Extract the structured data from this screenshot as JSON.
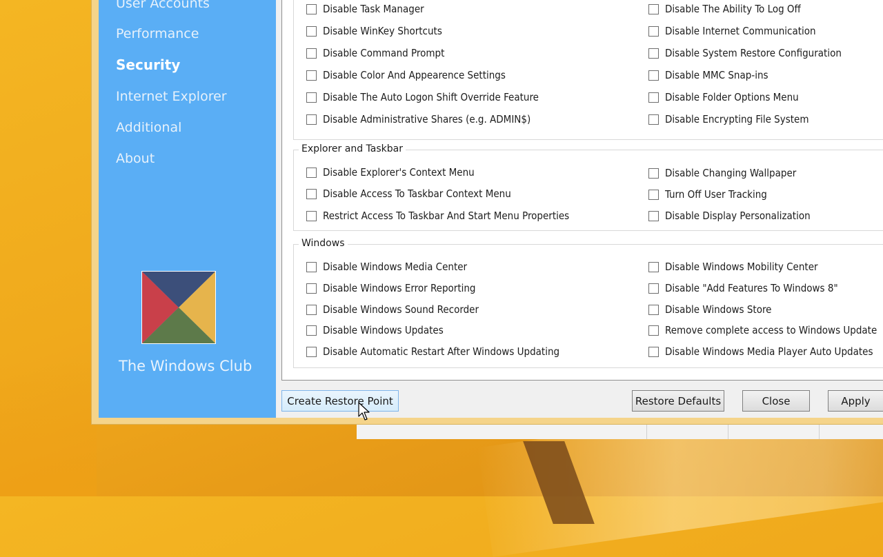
{
  "sidebar": {
    "items": [
      {
        "label": "User Accounts",
        "active": false
      },
      {
        "label": "Performance",
        "active": false
      },
      {
        "label": "Security",
        "active": true
      },
      {
        "label": "Internet Explorer",
        "active": false
      },
      {
        "label": "Additional",
        "active": false
      },
      {
        "label": "About",
        "active": false
      }
    ],
    "brand": "The Windows Club",
    "accent_color": "#5aaef5"
  },
  "groups": {
    "system": {
      "left": [
        "Disable Task Manager",
        "Disable WinKey Shortcuts",
        "Disable Command Prompt",
        "Disable Color And Appearence Settings",
        "Disable The Auto Logon Shift Override Feature",
        "Disable Administrative Shares (e.g. ADMIN$)"
      ],
      "right": [
        "Disable The Ability To Log Off",
        "Disable Internet Communication",
        "Disable System Restore Configuration",
        "Disable MMC Snap-ins",
        "Disable Folder Options Menu",
        "Disable Encrypting File System"
      ]
    },
    "explorer": {
      "title": "Explorer and Taskbar",
      "left": [
        "Disable Explorer's Context Menu",
        "Disable Access To Taskbar Context Menu",
        "Restrict Access To Taskbar And Start Menu Properties"
      ],
      "right": [
        "Disable Changing Wallpaper",
        "Turn Off User Tracking",
        "Disable Display Personalization"
      ]
    },
    "windows": {
      "title": "Windows",
      "left": [
        "Disable Windows Media Center",
        "Disable Windows Error Reporting",
        "Disable Windows Sound Recorder",
        "Disable Windows Updates",
        "Disable Automatic Restart After Windows Updating"
      ],
      "right": [
        "Disable Windows Mobility Center",
        "Disable \"Add Features To Windows 8\"",
        "Disable Windows Store",
        "Remove complete access to Windows Update",
        "Disable Windows Media Player Auto Updates"
      ]
    }
  },
  "buttons": {
    "create_restore_point": "Create Restore Point",
    "restore_defaults": "Restore Defaults",
    "close": "Close",
    "apply": "Apply"
  },
  "icons": {
    "logo": "windows-club-logo",
    "cursor": "mouse-pointer-icon"
  }
}
